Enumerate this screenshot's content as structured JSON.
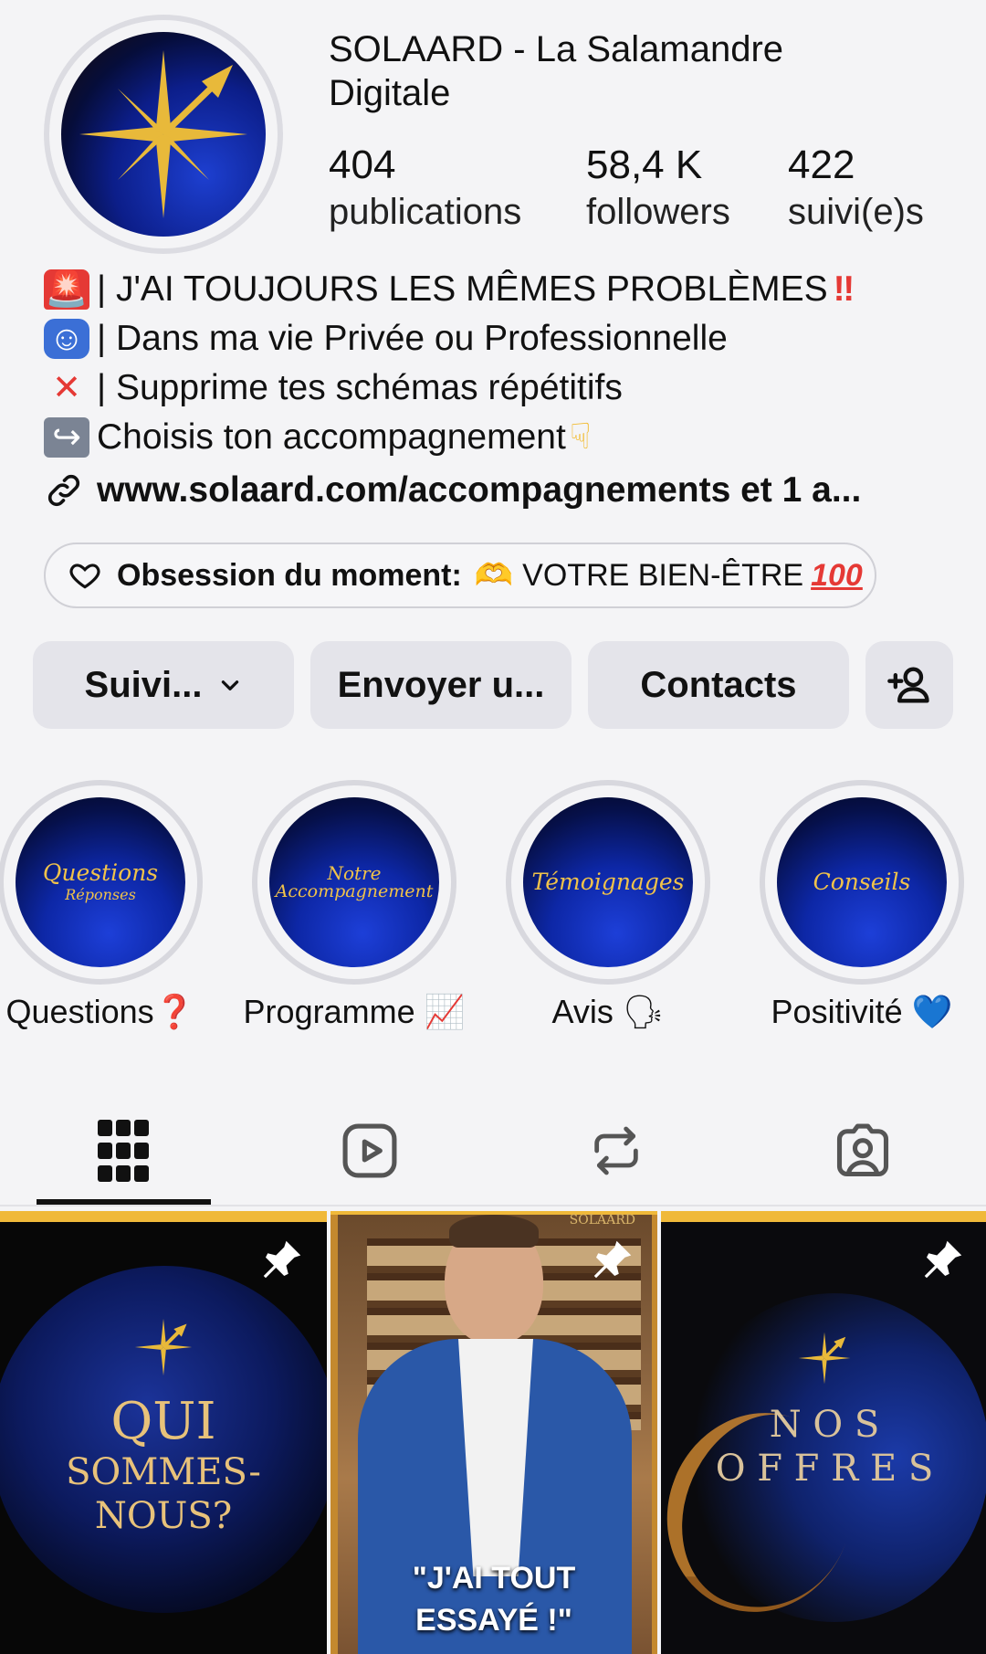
{
  "profile": {
    "name": "SOLAARD - La Salamandre Digitale",
    "stats": [
      {
        "value": "404",
        "label": "publications"
      },
      {
        "value": "58,4 K",
        "label": "followers"
      },
      {
        "value": "422",
        "label": "suivi(e)s"
      }
    ]
  },
  "bio": {
    "line1": "| J'AI TOUJOURS LES MÊMES PROBLÈMES",
    "line2": "| Dans ma vie Privée ou Professionnelle",
    "line3": "| Supprime tes schémas répétitifs",
    "line4": "Choisis ton accompagnement",
    "link": "www.solaard.com/accompagnements et 1 a..."
  },
  "obsession": {
    "label": "Obsession du moment:",
    "value": "VOTRE BIEN-ÊTRE"
  },
  "actions": {
    "follow_label": "Suivi...",
    "message_label": "Envoyer u...",
    "contacts_label": "Contacts"
  },
  "highlights": [
    {
      "cover_title": "Questions",
      "cover_sub": "Réponses",
      "label": "Questions❓"
    },
    {
      "cover_title": "Notre",
      "cover_sub": "Accompagnement",
      "label": "Programme 📈"
    },
    {
      "cover_title": "Témoignages",
      "cover_sub": "",
      "label": "Avis 🗣"
    },
    {
      "cover_title": "Conseils",
      "cover_sub": "",
      "label": "Positivité 💙"
    }
  ],
  "posts": [
    {
      "line1": "QUI",
      "line2": "SOMMES-NOUS?"
    },
    {
      "line1": "\"J'AI TOUT",
      "line2": "ESSAYÉ !\"",
      "brand": "SOLAARD"
    },
    {
      "line1": "N O S",
      "line2": "O F F R E S"
    }
  ],
  "colors": {
    "background": "#f4f4f6",
    "button": "#e4e4ea",
    "gold": "#f0c24a",
    "alert_red": "#e53935"
  },
  "icons": [
    "compass-star-icon",
    "link-icon",
    "heart-icon",
    "chevron-down-icon",
    "add-person-icon",
    "grid-icon",
    "reels-icon",
    "reposts-icon",
    "tagged-icon",
    "pin-icon"
  ]
}
